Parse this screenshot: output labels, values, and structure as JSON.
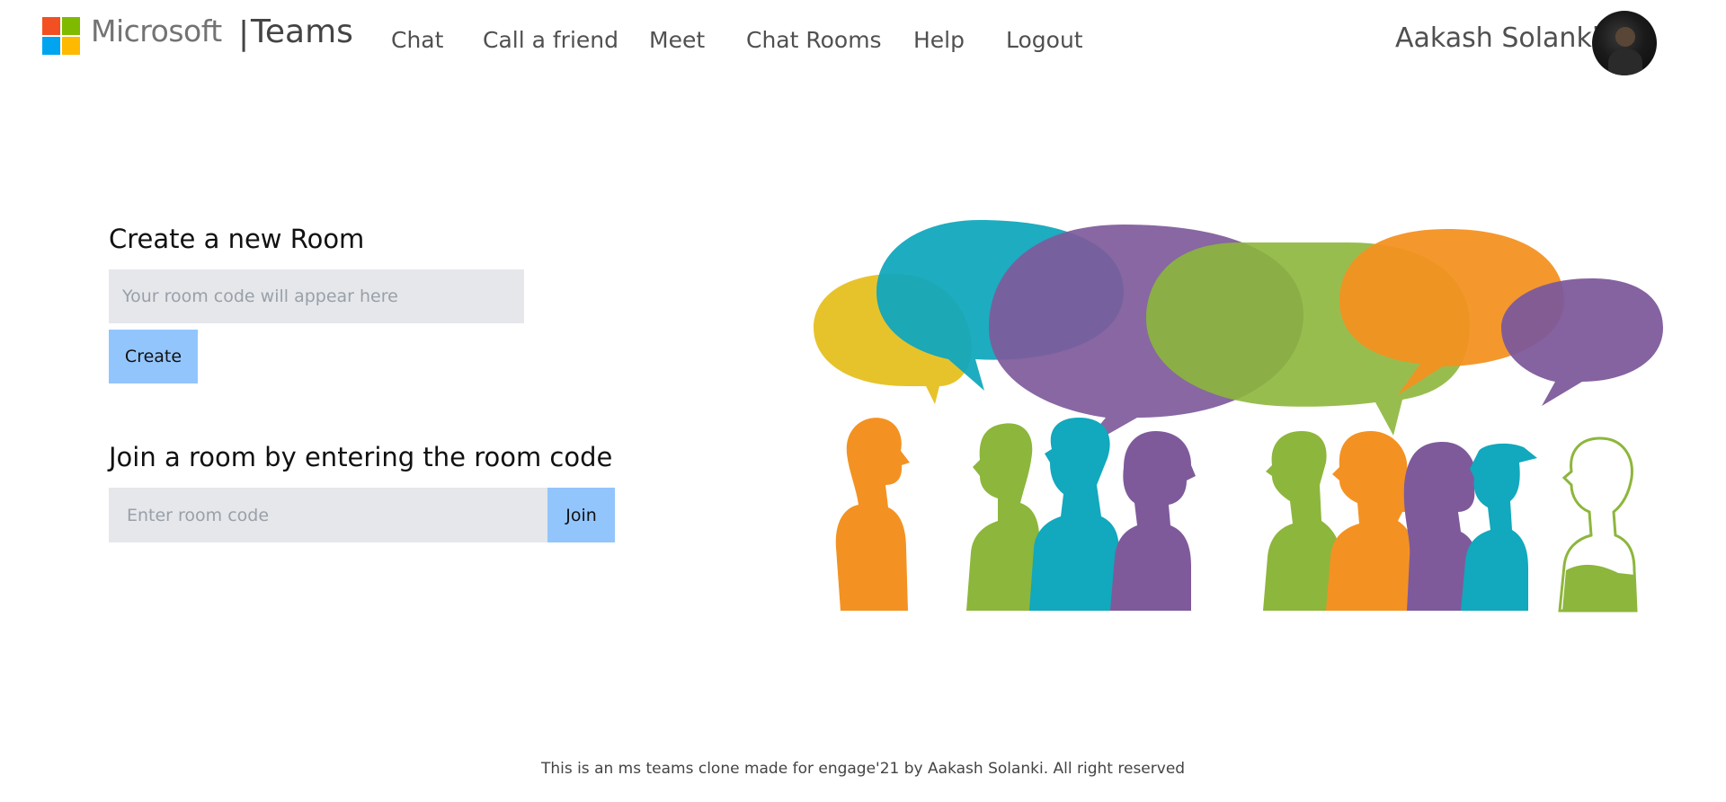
{
  "header": {
    "brand": "Microsoft",
    "separator": "|",
    "app_name": "Teams",
    "logo_colors": [
      "#f25022",
      "#7fba00",
      "#00a4ef",
      "#ffb900"
    ],
    "nav": [
      {
        "label": "Chat"
      },
      {
        "label": "Call a friend"
      },
      {
        "label": "Meet"
      },
      {
        "label": "Chat Rooms"
      },
      {
        "label": "Help"
      },
      {
        "label": "Logout"
      }
    ],
    "user_name": "Aakash Solanki"
  },
  "create_room": {
    "title": "Create a new Room",
    "placeholder": "Your room code will appear here",
    "button_label": "Create"
  },
  "join_room": {
    "title": "Join a room by entering the room code",
    "placeholder": "Enter room code",
    "button_label": "Join"
  },
  "footer": {
    "text": "This is an ms teams clone made for engage'21 by Aakash Solanki. All right reserved"
  },
  "colors": {
    "accent_button": "#93c5fd",
    "input_bg": "#e5e7eb",
    "illustration_yellow": "#e6c020",
    "illustration_teal": "#12a8bd",
    "illustration_purple": "#7e5a9b",
    "illustration_green": "#8db63c",
    "illustration_orange": "#f39222"
  }
}
